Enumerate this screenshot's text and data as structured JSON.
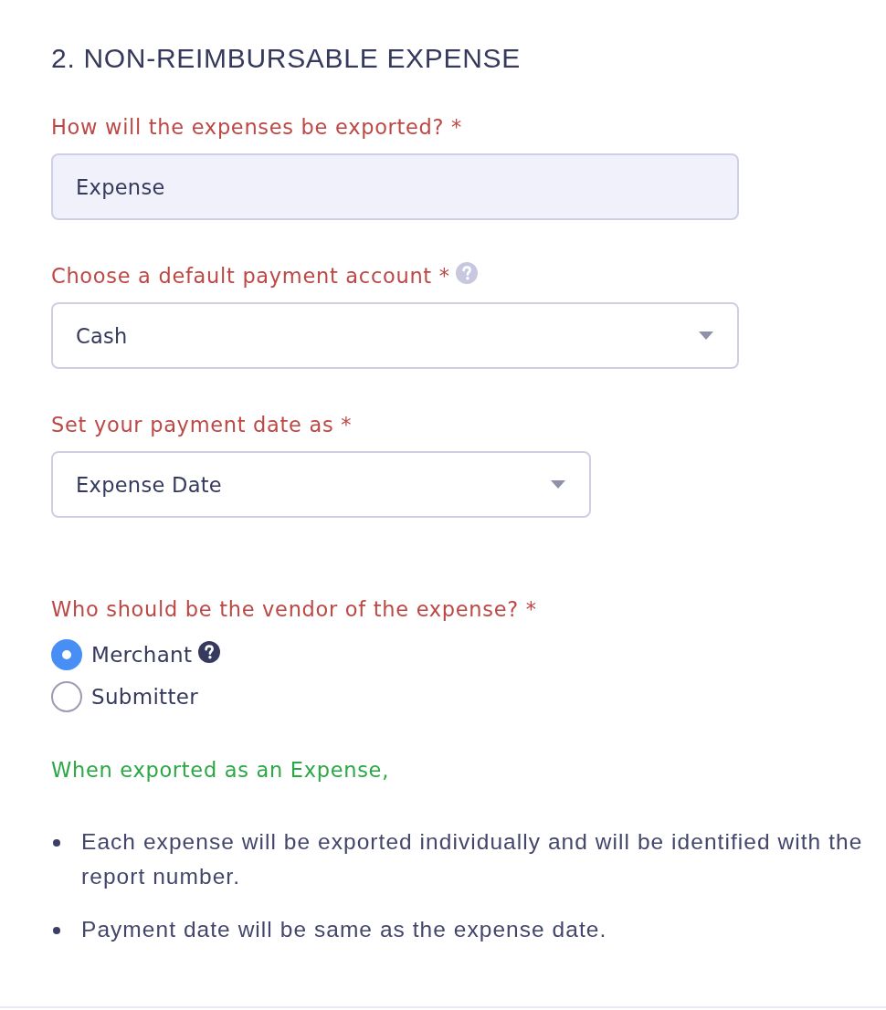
{
  "section": {
    "title": "2. NON-REIMBURSABLE EXPENSE"
  },
  "fields": [
    {
      "kind": "readonly",
      "label": "How will the expenses be exported? *",
      "help": false,
      "value": "Expense"
    },
    {
      "kind": "dropdown",
      "label": "Choose a default payment account *",
      "help": true,
      "value": "Cash"
    },
    {
      "kind": "dropdown",
      "label": "Set your payment date as *",
      "help": false,
      "value": "Expense Date"
    }
  ],
  "vendor": {
    "label": "Who should be the vendor of the expense? *",
    "options": [
      {
        "label": "Merchant",
        "selected": true,
        "help": true
      },
      {
        "label": "Submitter",
        "selected": false,
        "help": false
      }
    ]
  },
  "note": {
    "title": "When exported as an Expense,",
    "items": [
      "Each expense will be exported individually and will be identified with the report number.",
      "Payment date will be same as the expense date."
    ]
  }
}
